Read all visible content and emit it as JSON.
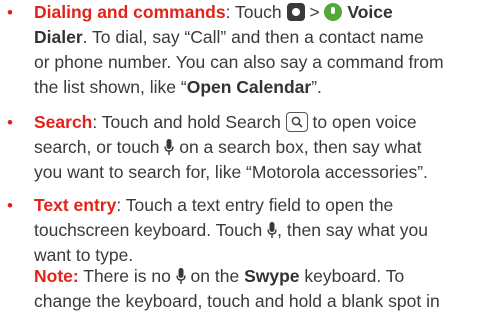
{
  "items": [
    {
      "bullet": "•",
      "lines": [
        {
          "a": "Dialing and commands",
          "b": ": Touch ",
          "c": " > ",
          "d": "Voice"
        },
        {
          "a": "Dialer",
          "b": ". To dial, say “Call” and then a contact name"
        },
        {
          "a": "or phone number. You can also say a command from"
        },
        {
          "a": "the list shown, like “",
          "b": "Open Calendar",
          "c": "”."
        }
      ],
      "icons": {
        "home": "home-button-icon",
        "app": "voice-dialer-app-icon"
      }
    },
    {
      "bullet": "•",
      "lines": [
        {
          "a": "Search",
          "b": ": Touch and hold Search ",
          "c": " to open voice"
        },
        {
          "a": "search, or touch ",
          "b": " on a search box, then say what"
        },
        {
          "a": "you want to search for, like “Motorola accessories”."
        }
      ],
      "icons": {
        "search": "search-key-icon",
        "mic": "microphone-icon"
      }
    },
    {
      "bullet": "•",
      "lines": [
        {
          "a": "Text entry",
          "b": ": Touch a text entry field to open the"
        },
        {
          "a": "touchscreen keyboard. Touch ",
          "b": ", then say what you"
        },
        {
          "a": "want to type."
        }
      ],
      "icons": {
        "mic": "microphone-icon"
      }
    }
  ],
  "note": {
    "lines": [
      {
        "a": "Note:",
        "b": " There is no ",
        "c": " on the ",
        "d": "Swype",
        "e": " keyboard. To"
      },
      {
        "a": "change the keyboard, touch and hold a blank spot in"
      }
    ],
    "icons": {
      "mic": "microphone-icon"
    }
  },
  "colors": {
    "accent": "#e2231a",
    "text": "#3a3a3a",
    "voice_icon": "#53a83a"
  }
}
